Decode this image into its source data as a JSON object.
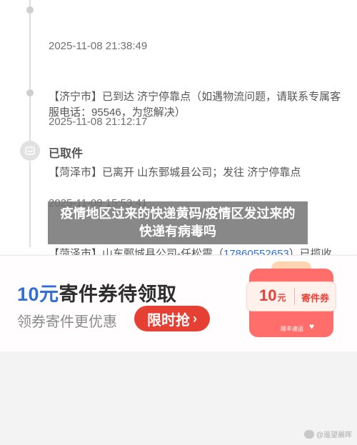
{
  "timeline": {
    "events": [
      {
        "time": "2025-11-08 21:38:49",
        "description": "【济宁市】已到达 济宁停靠点（如遇物流问题，请联系专属客服电话：95546，为您解决）"
      },
      {
        "time": "2025-11-08 21:12:17",
        "description": "【菏泽市】已离开 山东鄄城县公司；发往 济宁停靠点"
      }
    ],
    "status": {
      "title": "已取件",
      "icon": "package-smile-icon",
      "time": "2025-11-08 15:53:41",
      "description_prefix": "【菏泽市】山东鄄城县公司-任松震（",
      "phone": "17860552653",
      "description_suffix": "）已揽收"
    }
  },
  "overlay": {
    "text": "疫情地区过来的快递黄码/疫情区发过来的快递有病毒吗"
  },
  "coupon": {
    "title_amount": "10元",
    "title_text": "寄件券待领取",
    "subtitle": "领券寄件更优惠",
    "cta_label": "限时抢",
    "cta_icon": "chevron-right-icon",
    "card_amount": "10",
    "card_unit": "元",
    "card_label": "寄件券",
    "card_brand": "顺丰速运"
  },
  "watermark": {
    "text": "@遥望晨晖"
  },
  "colors": {
    "accent_blue": "#2f6fd8",
    "cta_red": "#e64034",
    "gift_red": "#ff6e6a",
    "overlay_gray": "#6e6e6e"
  }
}
